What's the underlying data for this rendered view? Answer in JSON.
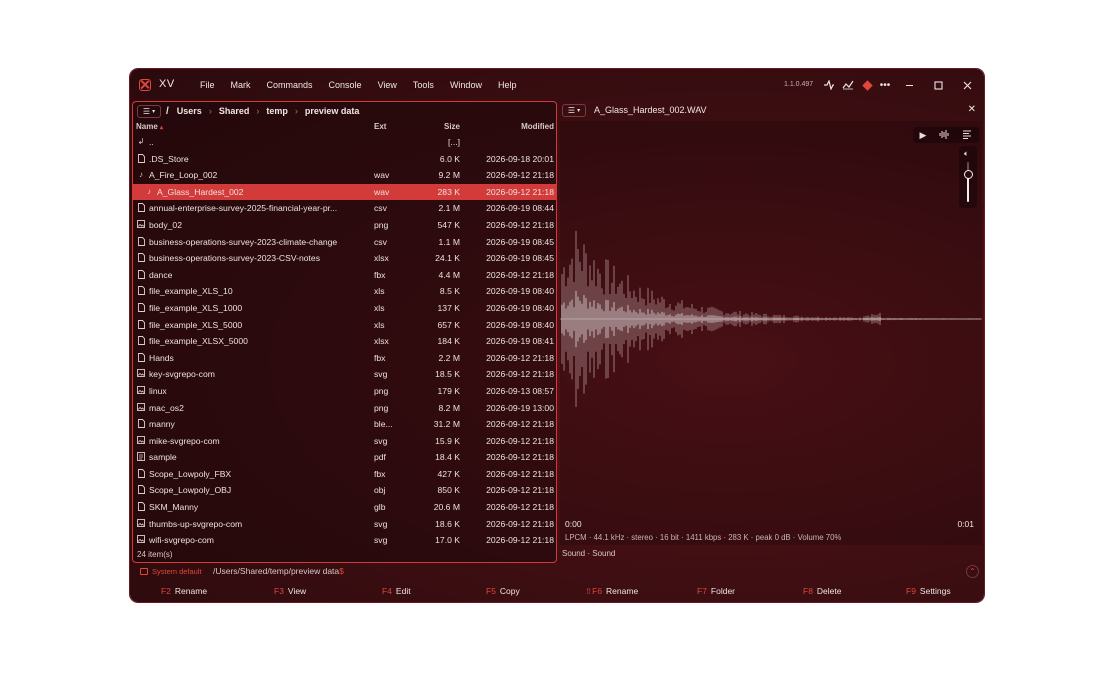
{
  "app": {
    "name": "XV",
    "version": "1.1.0.497"
  },
  "menu": [
    "File",
    "Mark",
    "Commands",
    "Console",
    "View",
    "Tools",
    "Window",
    "Help"
  ],
  "toolbar_icons": [
    "compare-icon",
    "chart-icon",
    "git-icon",
    "more-icon"
  ],
  "window_controls": [
    "minimize-icon",
    "maximize-icon",
    "close-icon"
  ],
  "path": {
    "root": "/",
    "segments": [
      "Users",
      "Shared",
      "temp",
      "preview data"
    ]
  },
  "columns": {
    "name": "Name",
    "sort_arrow": "▴",
    "ext": "Ext",
    "size": "Size",
    "modified": "Modified"
  },
  "parent_row": {
    "name": "..",
    "size": "[...]"
  },
  "files": [
    {
      "icon": "file",
      "name": ".DS_Store",
      "ext": "",
      "size": "6.0 K",
      "modified": "2026-09-18 20:01"
    },
    {
      "icon": "music",
      "name": "A_Fire_Loop_002",
      "ext": "wav",
      "size": "9.2 M",
      "modified": "2026-09-12 21:18"
    },
    {
      "icon": "music",
      "name": "A_Glass_Hardest_002",
      "ext": "wav",
      "size": "283 K",
      "modified": "2026-09-12 21:18",
      "selected": true
    },
    {
      "icon": "file",
      "name": "annual-enterprise-survey-2025-financial-year-pr...",
      "ext": "csv",
      "size": "2.1 M",
      "modified": "2026-09-19 08:44"
    },
    {
      "icon": "image",
      "name": "body_02",
      "ext": "png",
      "size": "547 K",
      "modified": "2026-09-12 21:18"
    },
    {
      "icon": "file",
      "name": "business-operations-survey-2023-climate-change",
      "ext": "csv",
      "size": "1.1 M",
      "modified": "2026-09-19 08:45"
    },
    {
      "icon": "file",
      "name": "business-operations-survey-2023-CSV-notes",
      "ext": "xlsx",
      "size": "24.1 K",
      "modified": "2026-09-19 08:45"
    },
    {
      "icon": "file",
      "name": "dance",
      "ext": "fbx",
      "size": "4.4 M",
      "modified": "2026-09-12 21:18"
    },
    {
      "icon": "file",
      "name": "file_example_XLS_10",
      "ext": "xls",
      "size": "8.5 K",
      "modified": "2026-09-19 08:40"
    },
    {
      "icon": "file",
      "name": "file_example_XLS_1000",
      "ext": "xls",
      "size": "137 K",
      "modified": "2026-09-19 08:40"
    },
    {
      "icon": "file",
      "name": "file_example_XLS_5000",
      "ext": "xls",
      "size": "657 K",
      "modified": "2026-09-19 08:40"
    },
    {
      "icon": "file",
      "name": "file_example_XLSX_5000",
      "ext": "xlsx",
      "size": "184 K",
      "modified": "2026-09-19 08:41"
    },
    {
      "icon": "file",
      "name": "Hands",
      "ext": "fbx",
      "size": "2.2 M",
      "modified": "2026-09-12 21:18"
    },
    {
      "icon": "image",
      "name": "key-svgrepo-com",
      "ext": "svg",
      "size": "18.5 K",
      "modified": "2026-09-12 21:18"
    },
    {
      "icon": "image",
      "name": "linux",
      "ext": "png",
      "size": "179 K",
      "modified": "2026-09-13 08:57"
    },
    {
      "icon": "image",
      "name": "mac_os2",
      "ext": "png",
      "size": "8.2 M",
      "modified": "2026-09-19 13:00"
    },
    {
      "icon": "file",
      "name": "manny",
      "ext": "ble...",
      "size": "31.2 M",
      "modified": "2026-09-12 21:18"
    },
    {
      "icon": "image",
      "name": "mike-svgrepo-com",
      "ext": "svg",
      "size": "15.9 K",
      "modified": "2026-09-12 21:18"
    },
    {
      "icon": "pdf",
      "name": "sample",
      "ext": "pdf",
      "size": "18.4 K",
      "modified": "2026-09-12 21:18"
    },
    {
      "icon": "file",
      "name": "Scope_Lowpoly_FBX",
      "ext": "fbx",
      "size": "427 K",
      "modified": "2026-09-12 21:18"
    },
    {
      "icon": "file",
      "name": "Scope_Lowpoly_OBJ",
      "ext": "obj",
      "size": "850 K",
      "modified": "2026-09-12 21:18"
    },
    {
      "icon": "file",
      "name": "SKM_Manny",
      "ext": "glb",
      "size": "20.6 M",
      "modified": "2026-09-12 21:18"
    },
    {
      "icon": "image",
      "name": "thumbs-up-svgrepo-com",
      "ext": "svg",
      "size": "18.6 K",
      "modified": "2026-09-12 21:18"
    },
    {
      "icon": "image",
      "name": "wifi-svgrepo-com",
      "ext": "svg",
      "size": "17.0 K",
      "modified": "2026-09-12 21:18"
    }
  ],
  "status_left": "24 item(s)",
  "preview": {
    "title": "A_Glass_Hardest_002.WAV",
    "time_start": "0:00",
    "time_end": "0:01",
    "info": "LPCM · 44.1 kHz · stereo · 16 bit · 1411 kbps · 283 K · peak 0 dB · Volume 70%",
    "volume_fraction": 0.7,
    "tools": [
      "play-icon",
      "waveform-icon",
      "list-icon"
    ],
    "status": "Sound · Sound"
  },
  "cmdline": {
    "system_label": "System default",
    "path": "/Users/Shared/temp/preview data",
    "prompt": "$"
  },
  "fkeys": [
    {
      "key": "F2",
      "label": "Rename"
    },
    {
      "key": "F3",
      "label": "View"
    },
    {
      "key": "F4",
      "label": "Edit"
    },
    {
      "key": "F5",
      "label": "Copy"
    },
    {
      "key": "⇧F6",
      "label": "Rename"
    },
    {
      "key": "F7",
      "label": "Folder"
    },
    {
      "key": "F8",
      "label": "Delete"
    },
    {
      "key": "F9",
      "label": "Settings"
    }
  ],
  "colors": {
    "accent": "#d33a3a",
    "accent_text": "#e0463c",
    "background": "#3d0e12",
    "waveform": "#e8dcdc"
  }
}
